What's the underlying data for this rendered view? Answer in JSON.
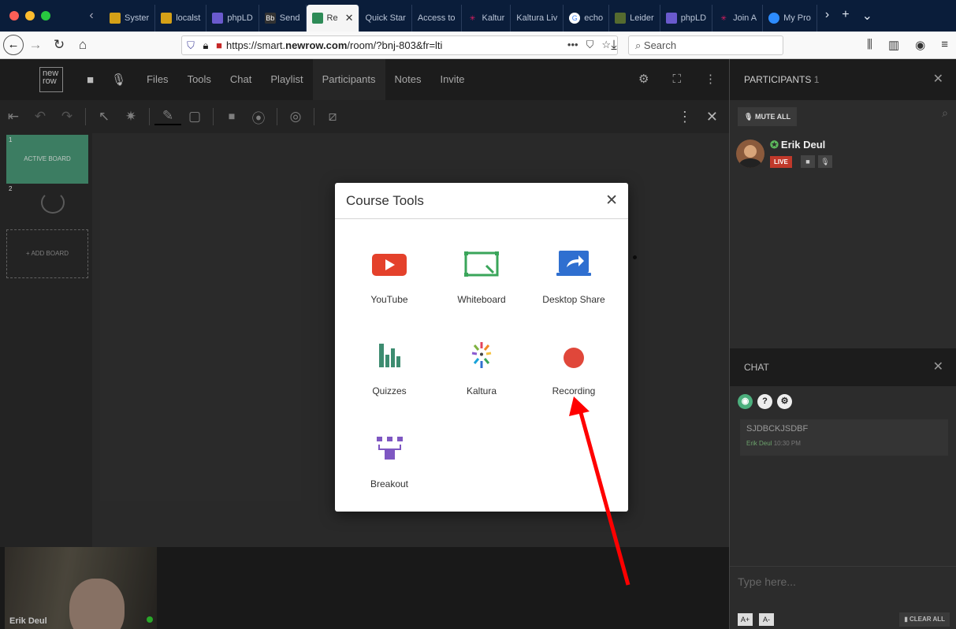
{
  "browser": {
    "tabs": [
      {
        "label": "Syster",
        "icon_color": "#d4a017"
      },
      {
        "label": "localst",
        "icon_color": "#d4a017"
      },
      {
        "label": "phpLD",
        "icon_color": "#6a5acd"
      },
      {
        "label": "Send",
        "icon_color": "#333"
      },
      {
        "label": "Re",
        "icon_color": "#2e8b57",
        "active": true
      },
      {
        "label": "Quick Star",
        "icon_color": "#0a1d3a"
      },
      {
        "label": "Access to",
        "icon_color": "#0a1d3a"
      },
      {
        "label": "Kaltur",
        "icon_color": "#e91e63"
      },
      {
        "label": "Kaltura Liv",
        "icon_color": "#0a1d3a"
      },
      {
        "label": "echo",
        "icon_color": "#fff"
      },
      {
        "label": "Leider",
        "icon_color": "#556b2f"
      },
      {
        "label": "phpLD",
        "icon_color": "#6a5acd"
      },
      {
        "label": "Join A",
        "icon_color": "#e91e63"
      },
      {
        "label": "My Pro",
        "icon_color": "#2d8cff"
      }
    ],
    "url": "https://smart.newrow.com/room/?bnj-803&fr=lti",
    "url_host_bold": "newrow.com",
    "search_placeholder": "Search"
  },
  "app": {
    "logo": "new row",
    "menu": [
      "Files",
      "Tools",
      "Chat",
      "Playlist",
      "Participants",
      "Notes",
      "Invite"
    ],
    "selected_menu": "Participants"
  },
  "participants": {
    "title": "PARTICIPANTS",
    "count": "1",
    "mute_all": "MUTE ALL",
    "user_name": "Erik Deul",
    "live": "LIVE"
  },
  "chat": {
    "title": "CHAT",
    "messages": [
      {
        "text": "SJDBCKJSDBF",
        "author": "Erik Deul",
        "time": "10:30 PM"
      }
    ],
    "input_placeholder": "Type here...",
    "font_up": "A+",
    "font_down": "A-",
    "clear_all": "CLEAR ALL"
  },
  "boards": {
    "items": [
      {
        "num": "1",
        "label": "ACTIVE BOARD"
      },
      {
        "num": "2",
        "label": ""
      }
    ],
    "add_label": "+ ADD BOARD"
  },
  "video": {
    "name": "Erik Deul"
  },
  "modal": {
    "title": "Course Tools",
    "tools": [
      {
        "label": "YouTube",
        "icon": "youtube-icon"
      },
      {
        "label": "Whiteboard",
        "icon": "whiteboard-icon"
      },
      {
        "label": "Desktop Share",
        "icon": "desktop-share-icon"
      },
      {
        "label": "Quizzes",
        "icon": "quizzes-icon"
      },
      {
        "label": "Kaltura",
        "icon": "kaltura-icon"
      },
      {
        "label": "Recording",
        "icon": "recording-icon"
      },
      {
        "label": "Breakout",
        "icon": "breakout-icon"
      }
    ]
  },
  "colors": {
    "accent_green": "#4a9978",
    "record_red": "#e0473a",
    "arrow_red": "#ff0000"
  }
}
